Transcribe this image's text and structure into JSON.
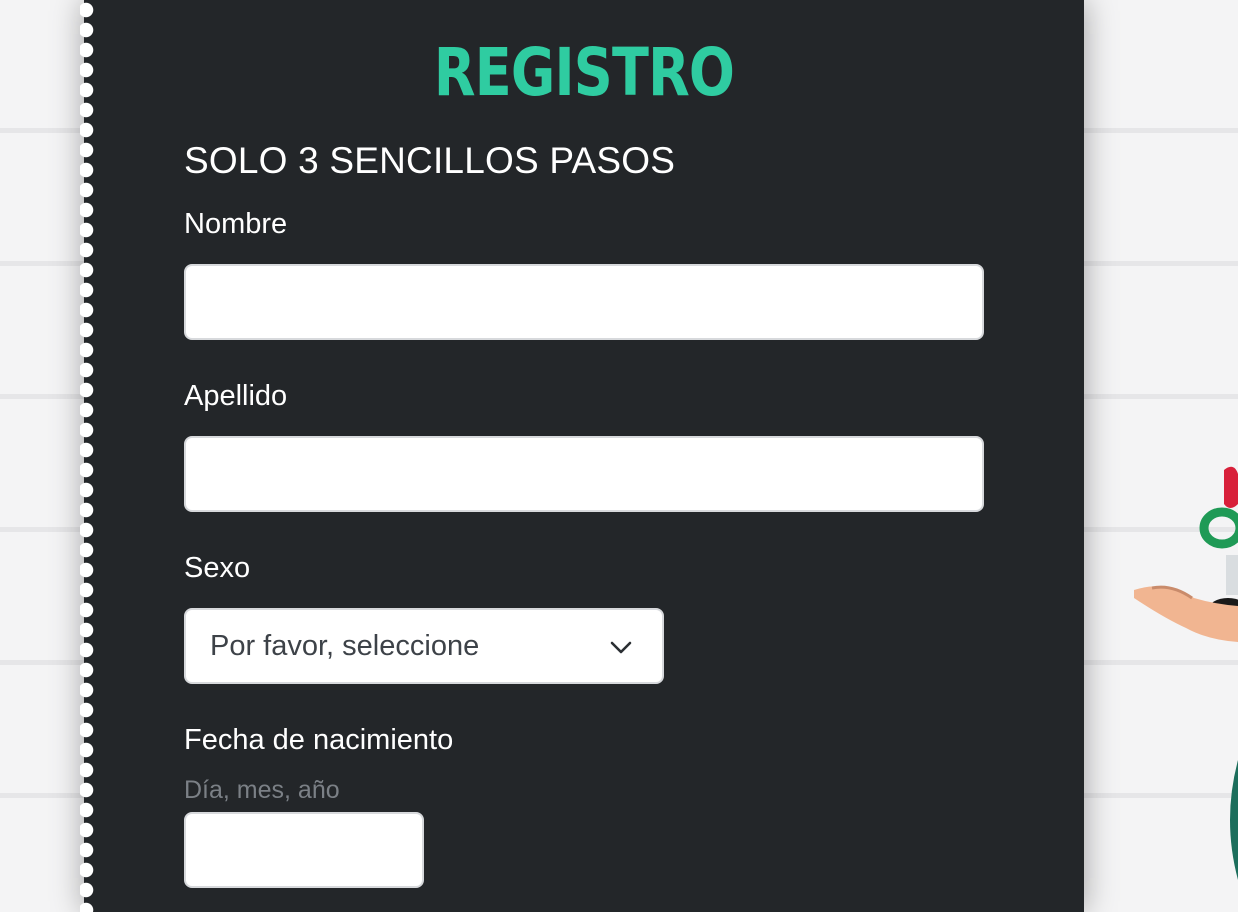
{
  "form": {
    "title": "REGISTRO",
    "subtitle": "SOLO 3 SENCILLOS PASOS",
    "fields": {
      "first_name_label": "Nombre",
      "first_name_value": "",
      "last_name_label": "Apellido",
      "last_name_value": "",
      "sex_label": "Sexo",
      "sex_selected": "Por favor, seleccione",
      "birthdate_label": "Fecha de nacimiento",
      "birthdate_hint": "Día, mes, año",
      "birthdate_value": ""
    }
  },
  "icons": {
    "select_arrow": "chevron-down-icon",
    "mascot": "casino-chips-mascot"
  },
  "colors": {
    "accent": "#2fcca1",
    "panel": "#232629",
    "page_background": "#f4f4f5"
  }
}
